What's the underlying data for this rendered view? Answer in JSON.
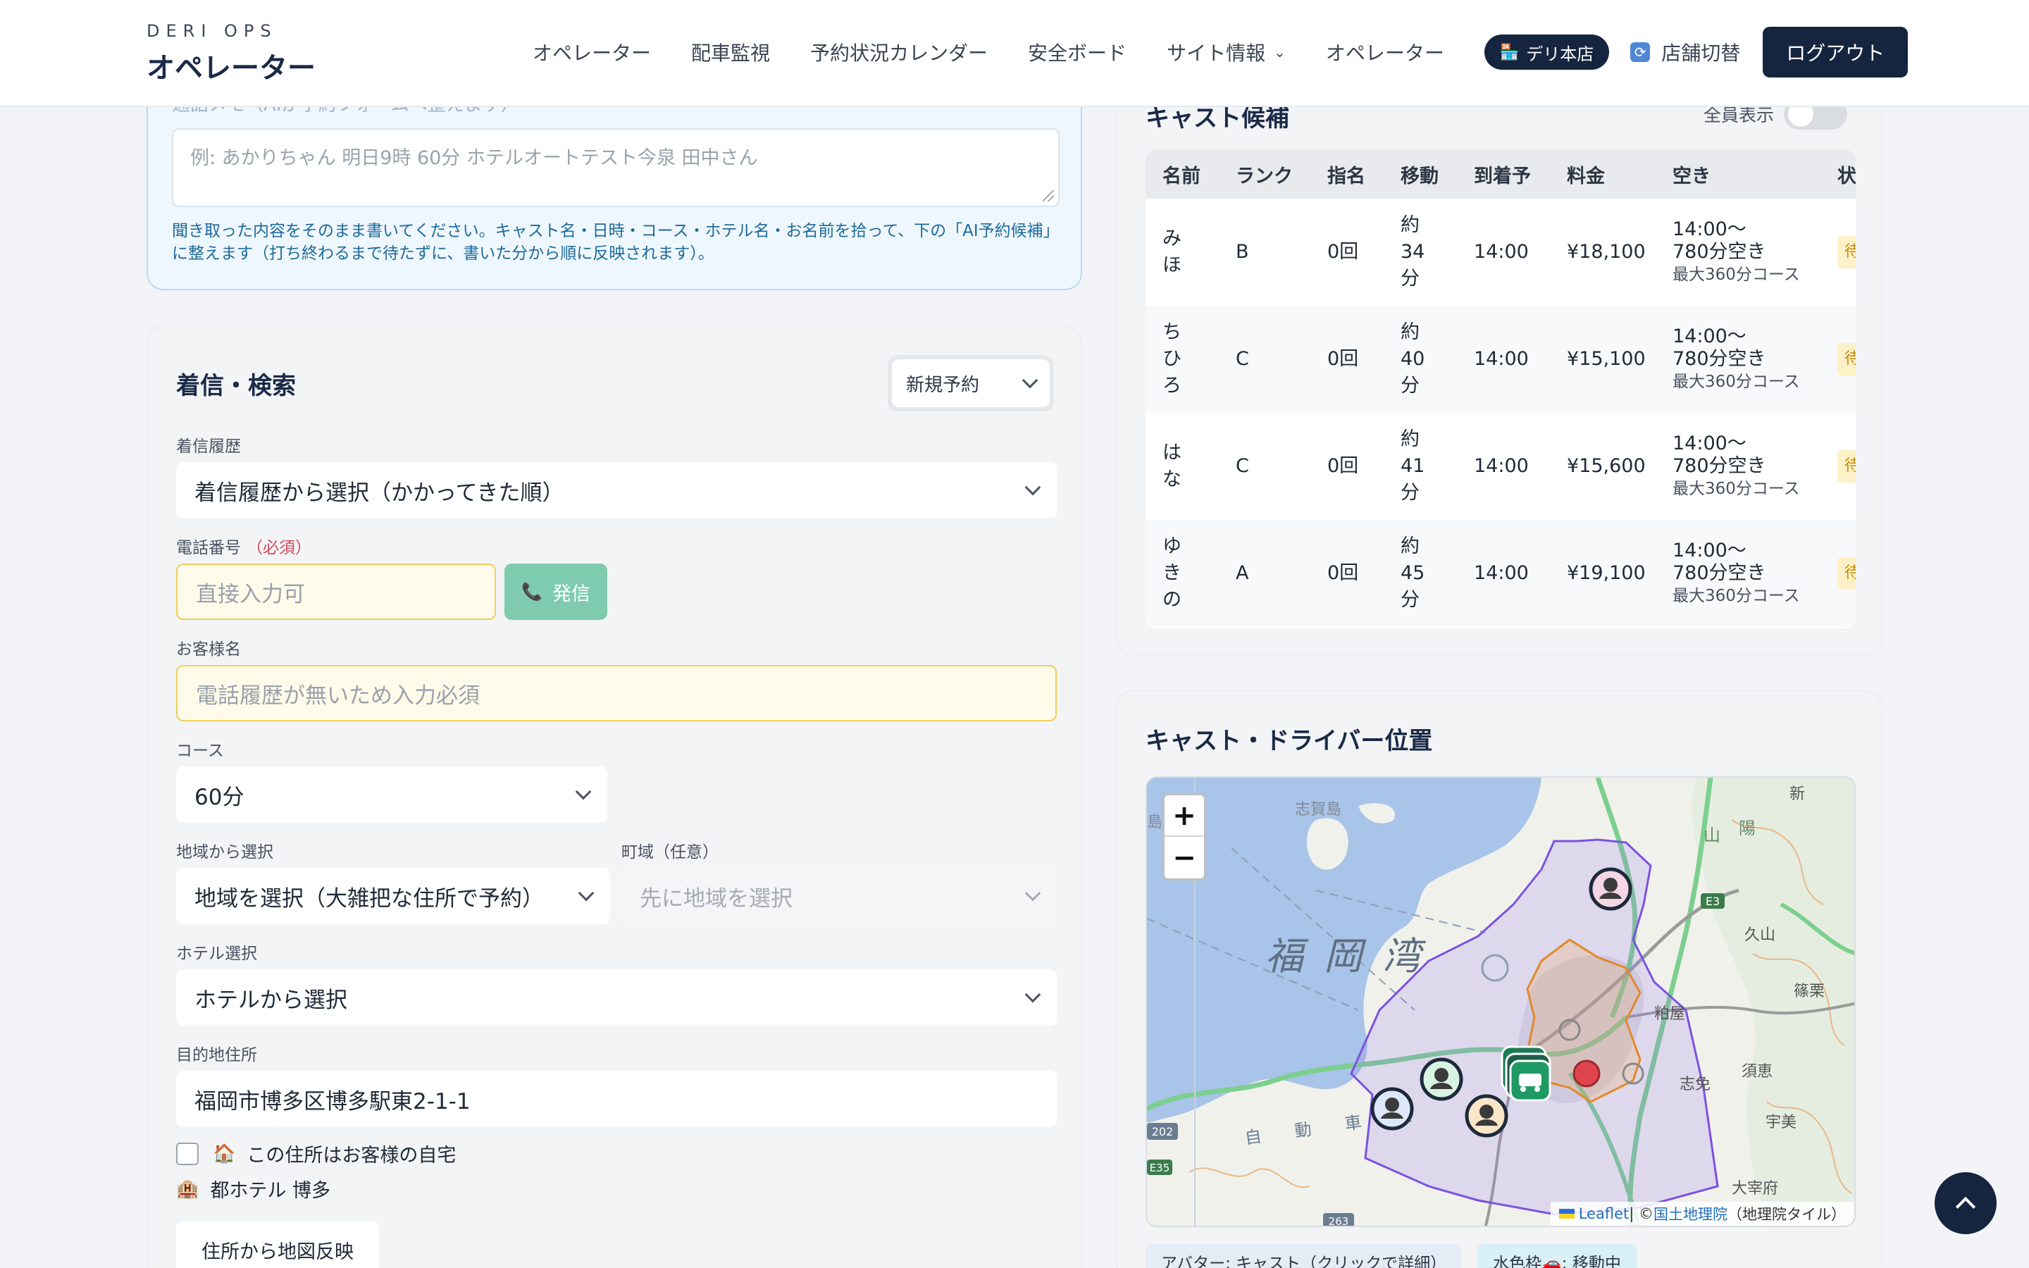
{
  "header": {
    "brand_sub": "DERI OPS",
    "brand_title": "オペレーター",
    "nav": [
      "オペレーター",
      "配車監視",
      "予約状況カレンダー",
      "安全ボード",
      "サイト情報",
      "オペレーター"
    ],
    "shop_badge": "デリ本店",
    "switch_label": "店舗切替",
    "logout_label": "ログアウト"
  },
  "memo": {
    "label": "通話メモ（AIが予約フォームへ整えます）",
    "placeholder": "例: あかりちゃん 明日9時 60分 ホテルオートテスト今泉 田中さん",
    "help": "聞き取った内容をそのまま書いてください。キャスト名・日時・コース・ホテル名・お名前を拾って、下の「AI予約候補」に整えます（打ち終わるまで待たずに、書いた分から順に反映されます）。"
  },
  "search": {
    "title": "着信・検索",
    "mode_select": "新規予約",
    "call_history_label": "着信履歴",
    "call_history_value": "着信履歴から選択（かかってきた順）",
    "phone_label": "電話番号",
    "required": "（必須）",
    "phone_placeholder": "直接入力可",
    "call_button": "発信",
    "customer_label": "お客様名",
    "customer_placeholder": "電話履歴が無いため入力必須",
    "course_label": "コース",
    "course_value": "60分",
    "area_label": "地域から選択",
    "area_value": "地域を選択（大雑把な住所で予約）",
    "town_label": "町域（任意）",
    "town_value": "先に地域を選択",
    "hotel_label": "ホテル選択",
    "hotel_value": "ホテルから選択",
    "address_label": "目的地住所",
    "address_value": "福岡市博多区博多駅東2-1-1",
    "home_checkbox_label": "この住所はお客様の自宅",
    "hotel_name": "都ホテル 博多",
    "map_reflect_button": "住所から地図反映"
  },
  "cast": {
    "title": "キャスト候補",
    "show_all_label": "全員表示",
    "columns": [
      "名前",
      "ランク",
      "指名",
      "移動",
      "到着予",
      "料金",
      "空き",
      "状"
    ],
    "rows": [
      {
        "name": "みほ",
        "rank": "B",
        "nominations": "0回",
        "move": "約34分",
        "eta": "14:00",
        "fee": "¥18,100",
        "free": "14:00〜780分空き",
        "free_sub": "最大360分コース",
        "status": "待"
      },
      {
        "name": "ちひろ",
        "rank": "C",
        "nominations": "0回",
        "move": "約40分",
        "eta": "14:00",
        "fee": "¥15,100",
        "free": "14:00〜780分空き",
        "free_sub": "最大360分コース",
        "status": "待"
      },
      {
        "name": "はな",
        "rank": "C",
        "nominations": "0回",
        "move": "約41分",
        "eta": "14:00",
        "fee": "¥15,600",
        "free": "14:00〜780分空き",
        "free_sub": "最大360分コース",
        "status": "待"
      },
      {
        "name": "ゆきの",
        "rank": "A",
        "nominations": "0回",
        "move": "約45分",
        "eta": "14:00",
        "fee": "¥19,100",
        "free": "14:00〜780分空き",
        "free_sub": "最大360分コース",
        "status": "待"
      }
    ]
  },
  "map": {
    "title": "キャスト・ドライバー位置",
    "zoom_in": "+",
    "zoom_out": "−",
    "labels": {
      "bay": "福 岡 湾",
      "shikanoshima": "志賀島",
      "kuyama": "久山",
      "sasaguri": "篠栗",
      "kasuya": "粕屋",
      "shime": "志免",
      "sue": "須恵",
      "umi": "宇美",
      "dazaifu": "大宰府",
      "shin": "新",
      "road_e3": "E3",
      "road_202": "202",
      "road_e35": "E35",
      "road_263": "263",
      "expressway": "自 動 車 道",
      "yama": "山",
      "yo": "陽",
      "shima": "島"
    },
    "attribution_leaflet": "Leaflet",
    "attribution_sep": " | © ",
    "attribution_gsi": "国土地理院",
    "attribution_tail": "（地理院タイル）",
    "legend": [
      "アバター: キャスト（クリックで詳細）",
      "水色枠🚗: 移動中"
    ]
  },
  "colors": {
    "navy": "#15253f",
    "accent_green": "#7fcbb0",
    "warn_yellow": "#fffbea",
    "memo_bg": "#eef7fd",
    "zone_purple": "#7b52e0",
    "zone_orange": "#e08a2b"
  }
}
